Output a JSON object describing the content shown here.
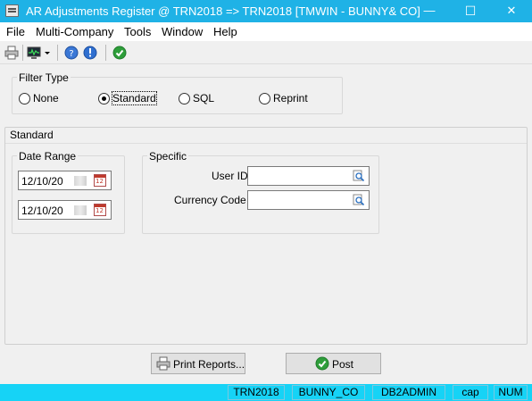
{
  "window": {
    "title": "AR Adjustments Register @ TRN2018 => TRN2018 [TMWIN - BUNNY& CO]",
    "controls": {
      "minimize": "—",
      "maximize": "☐",
      "close": "✕"
    }
  },
  "menubar": {
    "items": [
      {
        "label": "File"
      },
      {
        "label": "Multi-Company"
      },
      {
        "label": "Tools"
      },
      {
        "label": "Window"
      },
      {
        "label": "Help"
      }
    ]
  },
  "toolbar": {
    "icons": [
      "printer-icon",
      "monitor-icon",
      "dropdown-arrow-icon",
      "help-icon",
      "info-icon",
      "checkmark-icon"
    ]
  },
  "filter_type": {
    "label": "Filter Type",
    "options": [
      {
        "label": "None",
        "selected": false
      },
      {
        "label": "Standard",
        "selected": true
      },
      {
        "label": "SQL",
        "selected": false
      },
      {
        "label": "Reprint",
        "selected": false
      }
    ]
  },
  "standard": {
    "label": "Standard",
    "date_range": {
      "label": "Date Range",
      "from": "12/10/20",
      "to": "12/10/20"
    },
    "specific": {
      "label": "Specific",
      "user_id_label": "User ID",
      "user_id_value": "",
      "currency_code_label": "Currency Code",
      "currency_code_value": ""
    }
  },
  "buttons": {
    "print_reports": "Print Reports...",
    "post": "Post"
  },
  "statusbar": {
    "cells": [
      "TRN2018",
      "BUNNY_CO",
      "DB2ADMIN",
      "cap",
      "NUM"
    ]
  },
  "colors": {
    "titlebar": "#1fb2e6",
    "statusbar": "#16d3f6",
    "window_bg": "#f0f0f0"
  }
}
